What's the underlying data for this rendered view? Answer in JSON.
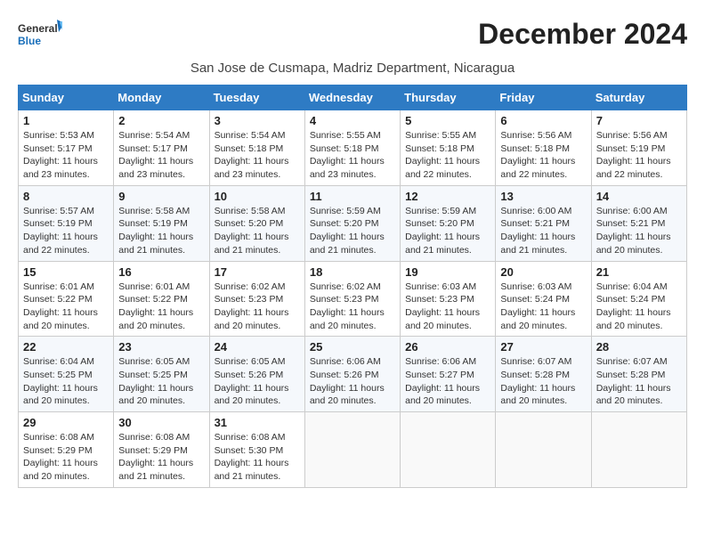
{
  "logo": {
    "line1": "General",
    "line2": "Blue"
  },
  "title": "December 2024",
  "subtitle": "San Jose de Cusmapa, Madriz Department, Nicaragua",
  "days_header": [
    "Sunday",
    "Monday",
    "Tuesday",
    "Wednesday",
    "Thursday",
    "Friday",
    "Saturday"
  ],
  "weeks": [
    [
      {
        "day": "1",
        "sunrise": "5:53 AM",
        "sunset": "5:17 PM",
        "daylight": "11 hours and 23 minutes."
      },
      {
        "day": "2",
        "sunrise": "5:54 AM",
        "sunset": "5:17 PM",
        "daylight": "11 hours and 23 minutes."
      },
      {
        "day": "3",
        "sunrise": "5:54 AM",
        "sunset": "5:18 PM",
        "daylight": "11 hours and 23 minutes."
      },
      {
        "day": "4",
        "sunrise": "5:55 AM",
        "sunset": "5:18 PM",
        "daylight": "11 hours and 23 minutes."
      },
      {
        "day": "5",
        "sunrise": "5:55 AM",
        "sunset": "5:18 PM",
        "daylight": "11 hours and 22 minutes."
      },
      {
        "day": "6",
        "sunrise": "5:56 AM",
        "sunset": "5:18 PM",
        "daylight": "11 hours and 22 minutes."
      },
      {
        "day": "7",
        "sunrise": "5:56 AM",
        "sunset": "5:19 PM",
        "daylight": "11 hours and 22 minutes."
      }
    ],
    [
      {
        "day": "8",
        "sunrise": "5:57 AM",
        "sunset": "5:19 PM",
        "daylight": "11 hours and 22 minutes."
      },
      {
        "day": "9",
        "sunrise": "5:58 AM",
        "sunset": "5:19 PM",
        "daylight": "11 hours and 21 minutes."
      },
      {
        "day": "10",
        "sunrise": "5:58 AM",
        "sunset": "5:20 PM",
        "daylight": "11 hours and 21 minutes."
      },
      {
        "day": "11",
        "sunrise": "5:59 AM",
        "sunset": "5:20 PM",
        "daylight": "11 hours and 21 minutes."
      },
      {
        "day": "12",
        "sunrise": "5:59 AM",
        "sunset": "5:20 PM",
        "daylight": "11 hours and 21 minutes."
      },
      {
        "day": "13",
        "sunrise": "6:00 AM",
        "sunset": "5:21 PM",
        "daylight": "11 hours and 21 minutes."
      },
      {
        "day": "14",
        "sunrise": "6:00 AM",
        "sunset": "5:21 PM",
        "daylight": "11 hours and 20 minutes."
      }
    ],
    [
      {
        "day": "15",
        "sunrise": "6:01 AM",
        "sunset": "5:22 PM",
        "daylight": "11 hours and 20 minutes."
      },
      {
        "day": "16",
        "sunrise": "6:01 AM",
        "sunset": "5:22 PM",
        "daylight": "11 hours and 20 minutes."
      },
      {
        "day": "17",
        "sunrise": "6:02 AM",
        "sunset": "5:23 PM",
        "daylight": "11 hours and 20 minutes."
      },
      {
        "day": "18",
        "sunrise": "6:02 AM",
        "sunset": "5:23 PM",
        "daylight": "11 hours and 20 minutes."
      },
      {
        "day": "19",
        "sunrise": "6:03 AM",
        "sunset": "5:23 PM",
        "daylight": "11 hours and 20 minutes."
      },
      {
        "day": "20",
        "sunrise": "6:03 AM",
        "sunset": "5:24 PM",
        "daylight": "11 hours and 20 minutes."
      },
      {
        "day": "21",
        "sunrise": "6:04 AM",
        "sunset": "5:24 PM",
        "daylight": "11 hours and 20 minutes."
      }
    ],
    [
      {
        "day": "22",
        "sunrise": "6:04 AM",
        "sunset": "5:25 PM",
        "daylight": "11 hours and 20 minutes."
      },
      {
        "day": "23",
        "sunrise": "6:05 AM",
        "sunset": "5:25 PM",
        "daylight": "11 hours and 20 minutes."
      },
      {
        "day": "24",
        "sunrise": "6:05 AM",
        "sunset": "5:26 PM",
        "daylight": "11 hours and 20 minutes."
      },
      {
        "day": "25",
        "sunrise": "6:06 AM",
        "sunset": "5:26 PM",
        "daylight": "11 hours and 20 minutes."
      },
      {
        "day": "26",
        "sunrise": "6:06 AM",
        "sunset": "5:27 PM",
        "daylight": "11 hours and 20 minutes."
      },
      {
        "day": "27",
        "sunrise": "6:07 AM",
        "sunset": "5:28 PM",
        "daylight": "11 hours and 20 minutes."
      },
      {
        "day": "28",
        "sunrise": "6:07 AM",
        "sunset": "5:28 PM",
        "daylight": "11 hours and 20 minutes."
      }
    ],
    [
      {
        "day": "29",
        "sunrise": "6:08 AM",
        "sunset": "5:29 PM",
        "daylight": "11 hours and 20 minutes."
      },
      {
        "day": "30",
        "sunrise": "6:08 AM",
        "sunset": "5:29 PM",
        "daylight": "11 hours and 21 minutes."
      },
      {
        "day": "31",
        "sunrise": "6:08 AM",
        "sunset": "5:30 PM",
        "daylight": "11 hours and 21 minutes."
      },
      null,
      null,
      null,
      null
    ]
  ]
}
